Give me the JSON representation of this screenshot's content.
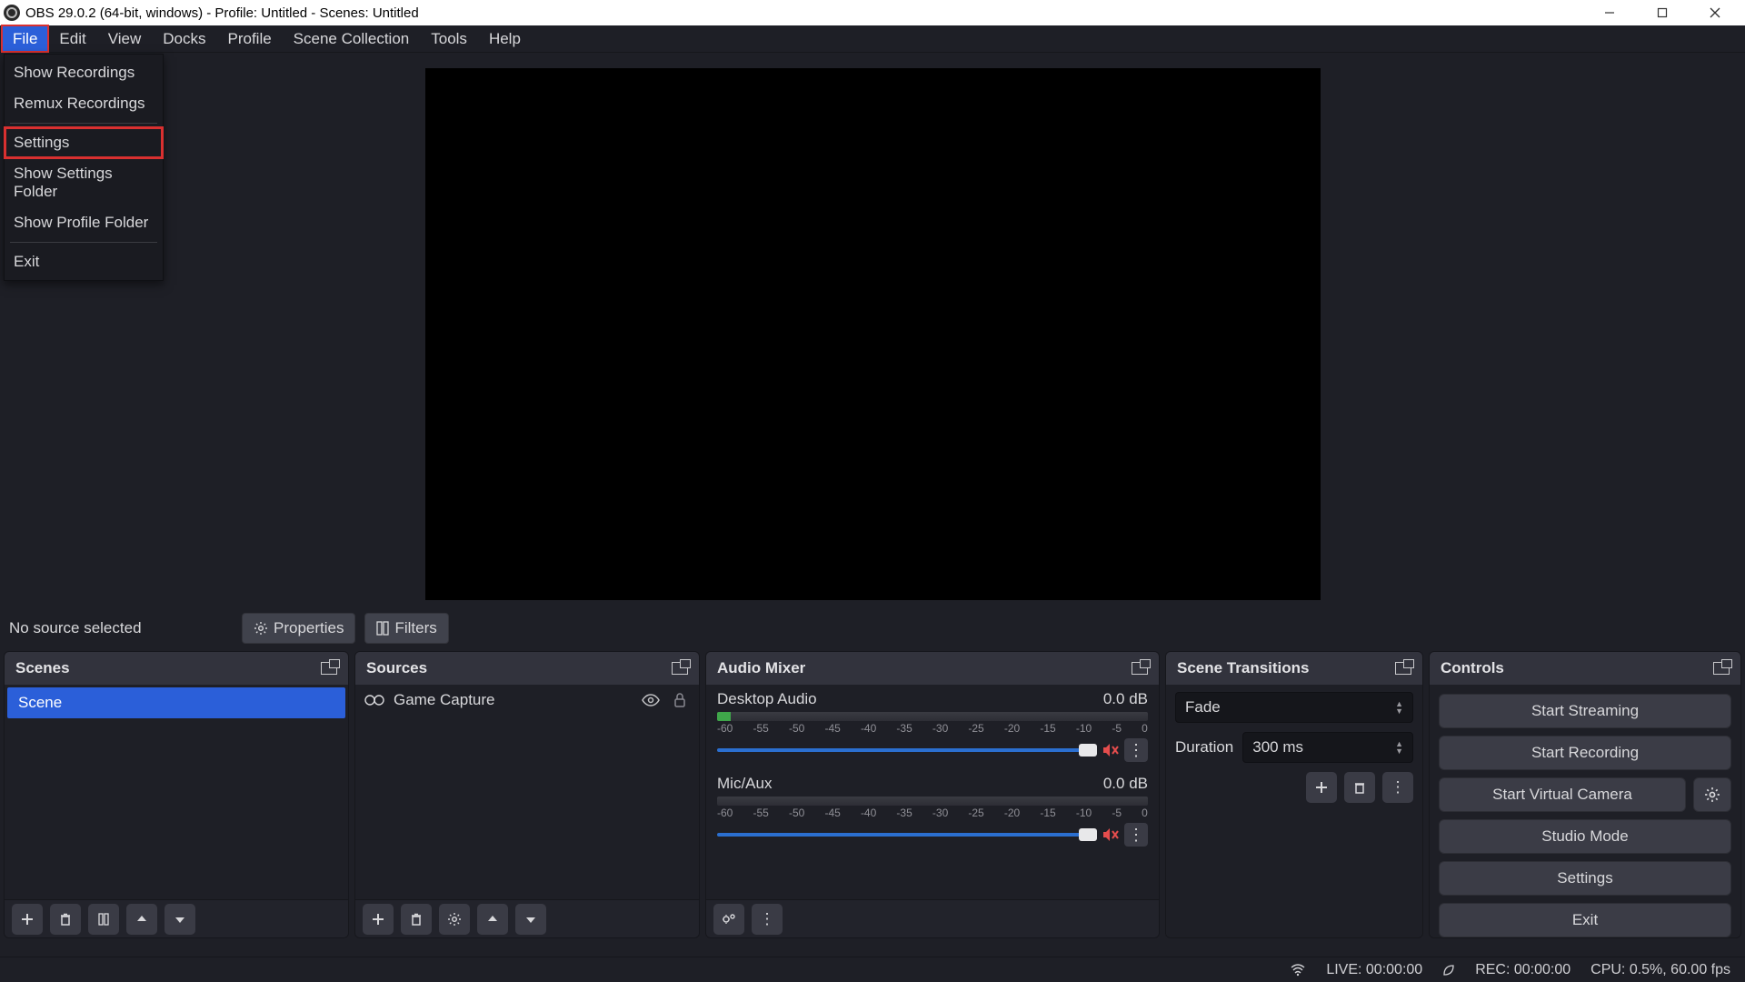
{
  "title": "OBS 29.0.2 (64-bit, windows) - Profile: Untitled - Scenes: Untitled",
  "menubar": [
    "File",
    "Edit",
    "View",
    "Docks",
    "Profile",
    "Scene Collection",
    "Tools",
    "Help"
  ],
  "filemenu": {
    "show_recordings": "Show Recordings",
    "remux_recordings": "Remux Recordings",
    "settings": "Settings",
    "show_settings_folder": "Show Settings Folder",
    "show_profile_folder": "Show Profile Folder",
    "exit": "Exit"
  },
  "info": {
    "no_source": "No source selected",
    "properties": "Properties",
    "filters": "Filters"
  },
  "panels": {
    "scenes": {
      "title": "Scenes",
      "items": [
        "Scene"
      ]
    },
    "sources": {
      "title": "Sources",
      "items": [
        {
          "icon": "vr-icon",
          "label": "Game Capture"
        }
      ]
    },
    "mixer": {
      "title": "Audio Mixer",
      "ticks": [
        "-60",
        "-55",
        "-50",
        "-45",
        "-40",
        "-35",
        "-30",
        "-25",
        "-20",
        "-15",
        "-10",
        "-5",
        "0"
      ],
      "tracks": [
        {
          "name": "Desktop Audio",
          "level": "0.0 dB"
        },
        {
          "name": "Mic/Aux",
          "level": "0.0 dB"
        }
      ]
    },
    "transitions": {
      "title": "Scene Transitions",
      "selected": "Fade",
      "duration_label": "Duration",
      "duration_value": "300 ms"
    },
    "controls": {
      "title": "Controls",
      "start_streaming": "Start Streaming",
      "start_recording": "Start Recording",
      "start_virtual_camera": "Start Virtual Camera",
      "studio_mode": "Studio Mode",
      "settings": "Settings",
      "exit": "Exit"
    }
  },
  "status": {
    "live": "LIVE: 00:00:00",
    "rec": "REC: 00:00:00",
    "cpu": "CPU: 0.5%, 60.00 fps"
  }
}
